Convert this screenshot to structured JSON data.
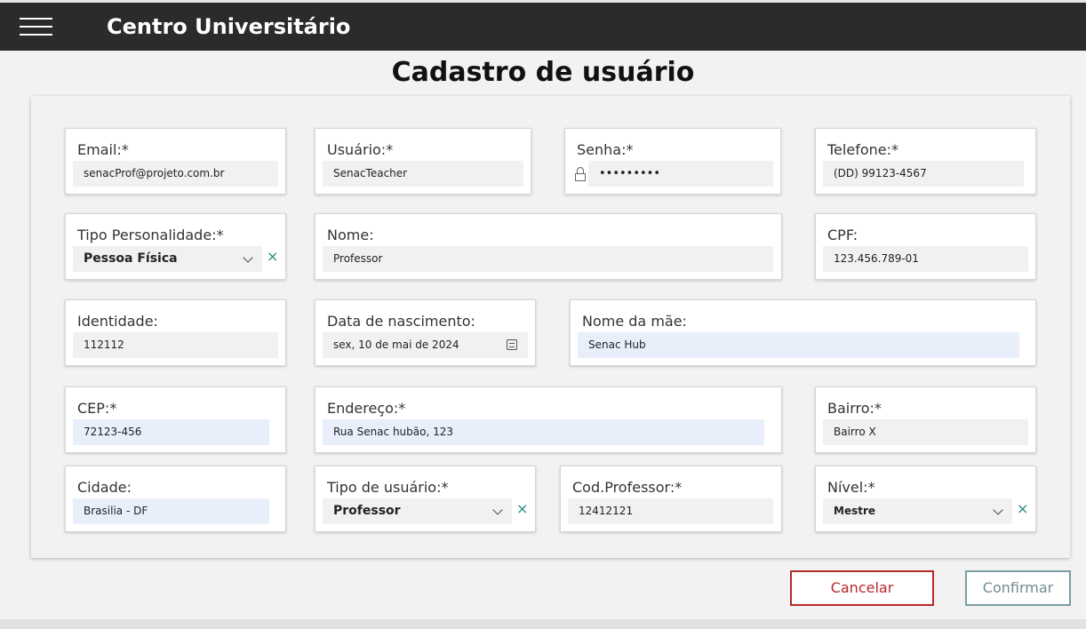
{
  "app": {
    "title": "Centro Universitário"
  },
  "page": {
    "title": "Cadastro de usuário"
  },
  "form": {
    "email": {
      "label": "Email:*",
      "value": "senacProf@projeto.com.br"
    },
    "usuario": {
      "label": "Usuário:*",
      "value": "SenacTeacher"
    },
    "senha": {
      "label": "Senha:*",
      "value": "•••••••••"
    },
    "telefone": {
      "label": "Telefone:*",
      "value": "(DD) 99123-4567"
    },
    "tipo_personalidade": {
      "label": "Tipo Personalidade:*",
      "value": "Pessoa Física"
    },
    "nome": {
      "label": "Nome:",
      "value": "Professor"
    },
    "cpf": {
      "label": "CPF:",
      "value": "123.456.789-01"
    },
    "identidade": {
      "label": "Identidade:",
      "value": "112112"
    },
    "data_nascimento": {
      "label": "Data de nascimento:",
      "value": "sex, 10 de mai de 2024"
    },
    "nome_mae": {
      "label": "Nome da mãe:",
      "value": "Senac Hub"
    },
    "cep": {
      "label": "CEP:*",
      "value": "72123-456"
    },
    "endereco": {
      "label": "Endereço:*",
      "value": "Rua Senac hubão, 123"
    },
    "bairro": {
      "label": "Bairro:*",
      "value": "Bairro X"
    },
    "cidade": {
      "label": "Cidade:",
      "value": "Brasilia - DF"
    },
    "tipo_usuario": {
      "label": "Tipo de usuário:*",
      "value": "Professor"
    },
    "cod_professor": {
      "label": "Cod.Professor:*",
      "value": "12412121"
    },
    "nivel": {
      "label": "Nível:*",
      "value": "Mestre"
    }
  },
  "icons": {
    "clear": "×",
    "menu": "hamburger-icon",
    "lock": "lock-icon",
    "calendar": "calendar-icon"
  },
  "actions": {
    "cancel_label": "Cancelar",
    "confirm_label": "Confirmar"
  },
  "colors": {
    "topbar": "#2b2b2b",
    "cancel": "#b72a2a",
    "confirm": "#6f8c92",
    "clear": "#2b8a87"
  }
}
